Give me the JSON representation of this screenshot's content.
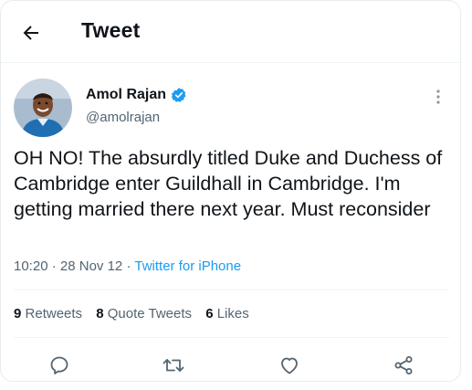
{
  "header": {
    "title": "Tweet",
    "back_icon": "arrow-left-icon"
  },
  "author": {
    "display_name": "Amol Rajan",
    "handle": "@amolrajan",
    "verified_color": "#1d9bf0"
  },
  "tweet": {
    "text": "OH NO! The absurdly titled Duke and Duchess of Cambridge enter Guildhall in Cambridge. I'm getting married there next year. Must reconsider",
    "time": "10:20",
    "date": "28 Nov 12",
    "separator": "·",
    "source": "Twitter for iPhone"
  },
  "stats": {
    "retweets_count": "9",
    "retweets_label": "Retweets",
    "quotes_count": "8",
    "quotes_label": "Quote Tweets",
    "likes_count": "6",
    "likes_label": "Likes"
  },
  "actions": [
    "reply-icon",
    "retweet-icon",
    "like-icon",
    "share-icon"
  ],
  "colors": {
    "accent": "#1d9bf0",
    "text_primary": "#0f1419",
    "text_secondary": "#536471",
    "divider": "#eff3f4"
  }
}
